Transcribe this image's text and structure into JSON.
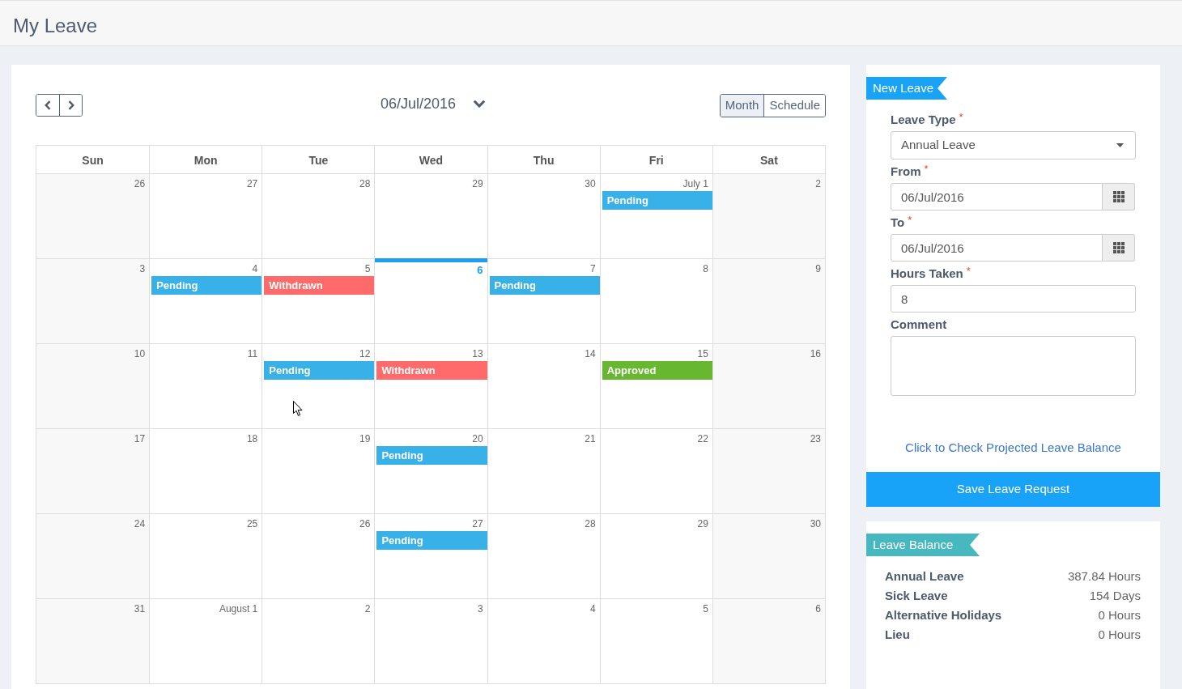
{
  "page": {
    "title": "My Leave"
  },
  "calendar": {
    "title": "06/Jul/2016",
    "views": [
      {
        "label": "Month",
        "selected": true
      },
      {
        "label": "Schedule",
        "selected": false
      }
    ],
    "weekdays": [
      "Sun",
      "Mon",
      "Tue",
      "Wed",
      "Thu",
      "Fri",
      "Sat"
    ],
    "weeks": [
      {
        "days": [
          {
            "date": "26",
            "today": false
          },
          {
            "date": "27",
            "today": false
          },
          {
            "date": "28",
            "today": false
          },
          {
            "date": "29",
            "today": false
          },
          {
            "date": "30",
            "today": false
          },
          {
            "date": "July 1",
            "today": false,
            "events": [
              {
                "label": "Pending",
                "color": "#38b0e8"
              }
            ]
          },
          {
            "date": "2",
            "today": false
          }
        ]
      },
      {
        "days": [
          {
            "date": "3",
            "today": false
          },
          {
            "date": "4",
            "today": false,
            "events": [
              {
                "label": "Pending",
                "color": "#38b0e8"
              }
            ]
          },
          {
            "date": "5",
            "today": false,
            "events": [
              {
                "label": "Withdrawn",
                "color": "#ff6b6b"
              }
            ]
          },
          {
            "date": "6",
            "today": true
          },
          {
            "date": "7",
            "today": false,
            "events": [
              {
                "label": "Pending",
                "color": "#38b0e8"
              }
            ]
          },
          {
            "date": "8",
            "today": false
          },
          {
            "date": "9",
            "today": false
          }
        ]
      },
      {
        "days": [
          {
            "date": "10",
            "today": false
          },
          {
            "date": "11",
            "today": false
          },
          {
            "date": "12",
            "today": false,
            "events": [
              {
                "label": "Pending",
                "color": "#38b0e8"
              }
            ]
          },
          {
            "date": "13",
            "today": false,
            "events": [
              {
                "label": "Withdrawn",
                "color": "#ff6b6b"
              }
            ]
          },
          {
            "date": "14",
            "today": false
          },
          {
            "date": "15",
            "today": false,
            "events": [
              {
                "label": "Approved",
                "color": "#67b731"
              }
            ]
          },
          {
            "date": "16",
            "today": false
          }
        ]
      },
      {
        "days": [
          {
            "date": "17",
            "today": false
          },
          {
            "date": "18",
            "today": false
          },
          {
            "date": "19",
            "today": false
          },
          {
            "date": "20",
            "today": false,
            "events": [
              {
                "label": "Pending",
                "color": "#38b0e8"
              }
            ]
          },
          {
            "date": "21",
            "today": false
          },
          {
            "date": "22",
            "today": false
          },
          {
            "date": "23",
            "today": false
          }
        ]
      },
      {
        "days": [
          {
            "date": "24",
            "today": false
          },
          {
            "date": "25",
            "today": false
          },
          {
            "date": "26",
            "today": false
          },
          {
            "date": "27",
            "today": false,
            "events": [
              {
                "label": "Pending",
                "color": "#38b0e8"
              }
            ]
          },
          {
            "date": "28",
            "today": false
          },
          {
            "date": "29",
            "today": false
          },
          {
            "date": "30",
            "today": false
          }
        ]
      },
      {
        "days": [
          {
            "date": "31",
            "today": false
          },
          {
            "date": "August 1",
            "today": false
          },
          {
            "date": "2",
            "today": false
          },
          {
            "date": "3",
            "today": false
          },
          {
            "date": "4",
            "today": false
          },
          {
            "date": "5",
            "today": false
          },
          {
            "date": "6",
            "today": false
          }
        ]
      }
    ]
  },
  "new_leave": {
    "title": "New Leave",
    "required_mark": "*",
    "fields": [
      {
        "kind": "select",
        "label": "Leave Type",
        "required": true,
        "value": "Annual Leave"
      },
      {
        "kind": "date",
        "label": "From",
        "required": true,
        "value": "06/Jul/2016"
      },
      {
        "kind": "date",
        "label": "To",
        "required": true,
        "value": "06/Jul/2016"
      },
      {
        "kind": "text",
        "label": "Hours Taken",
        "required": true,
        "value": "8"
      },
      {
        "kind": "textarea",
        "label": "Comment",
        "required": false
      }
    ],
    "link": "Click to Check Projected Leave Balance",
    "submit": "Save Leave Request"
  },
  "leave_balance": {
    "title": "Leave Balance",
    "rows": [
      {
        "label": "Annual Leave",
        "value": "387.84 Hours"
      },
      {
        "label": "Sick Leave",
        "value": "154 Days"
      },
      {
        "label": "Alternative Holidays",
        "value": "0 Hours"
      },
      {
        "label": "Lieu",
        "value": "0 Hours"
      }
    ]
  }
}
